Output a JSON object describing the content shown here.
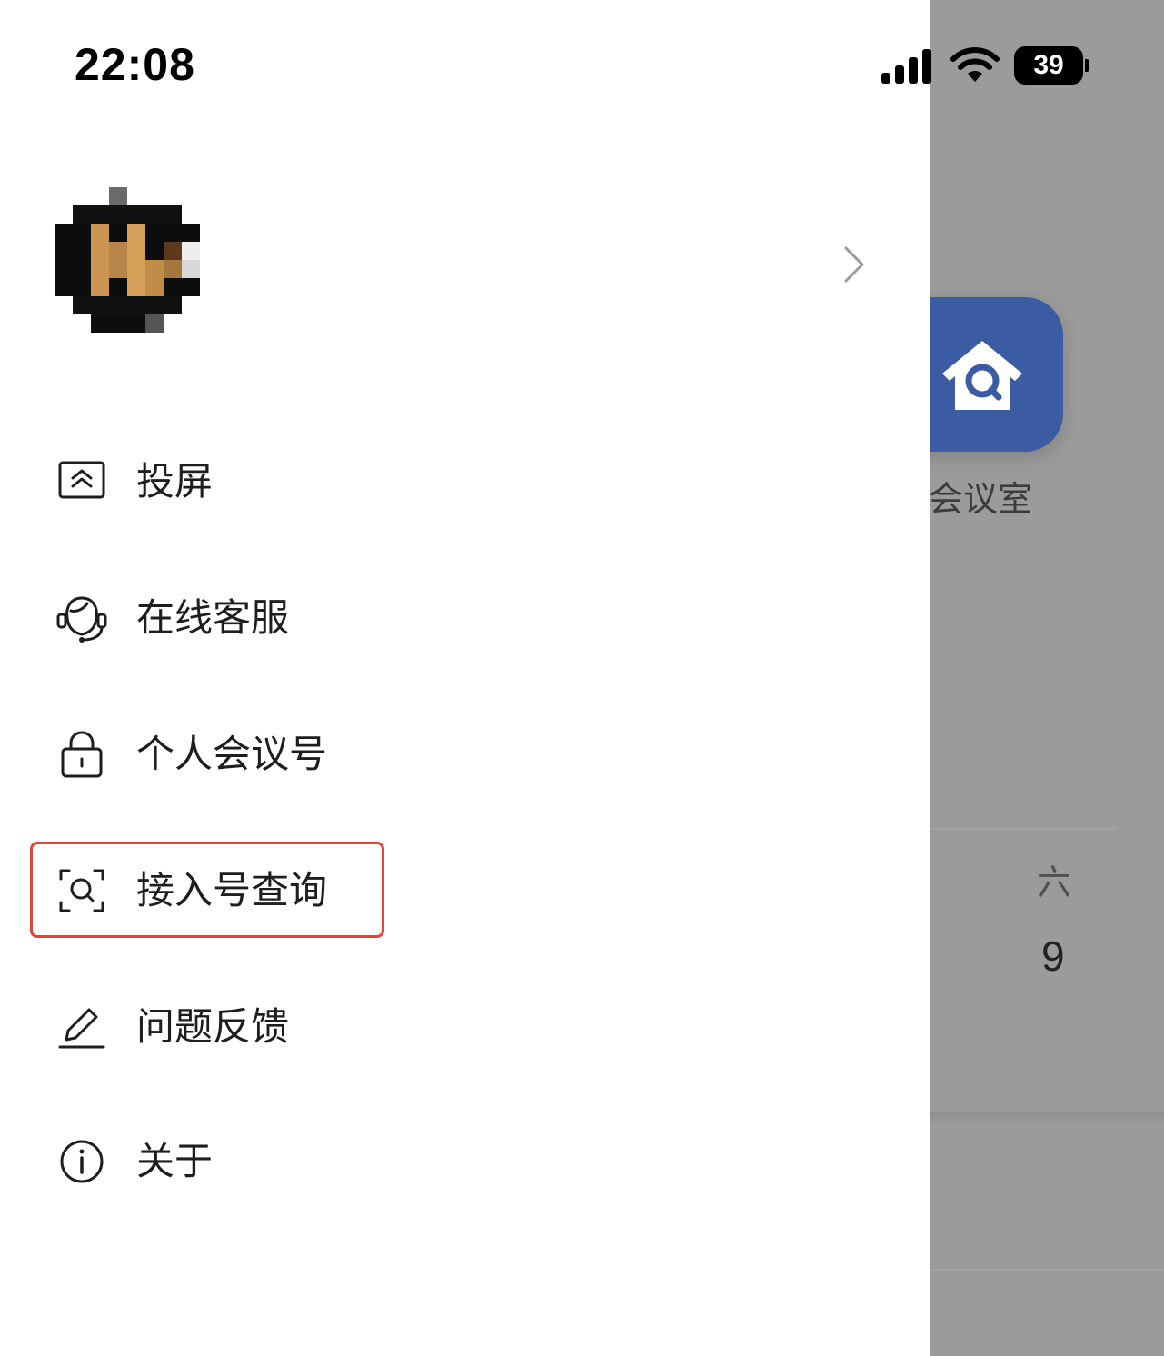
{
  "status_bar": {
    "time": "22:08",
    "battery_level": "39",
    "icons": [
      "signal-icon",
      "wifi-icon",
      "battery-icon"
    ]
  },
  "profile": {
    "name": "",
    "avatar_icon": "avatar-pixelated",
    "chevron_icon": "chevron-right-icon"
  },
  "menu": {
    "items": [
      {
        "label": "投屏",
        "icon": "screen-cast-icon"
      },
      {
        "label": "在线客服",
        "icon": "headset-agent-icon"
      },
      {
        "label": "个人会议号",
        "icon": "lock-icon"
      },
      {
        "label": "接入号查询",
        "icon": "scan-search-icon",
        "highlighted": true
      },
      {
        "label": "问题反馈",
        "icon": "pencil-icon"
      },
      {
        "label": "关于",
        "icon": "info-icon"
      }
    ]
  },
  "background_app": {
    "tile_label": "线会议室",
    "tile_icon": "house-search-icon",
    "tile_color": "#3b5ba3",
    "weekday": "六",
    "day": "9"
  },
  "colors": {
    "highlight_border": "#e0473b",
    "overlay_gray": "#9b9b9b"
  }
}
